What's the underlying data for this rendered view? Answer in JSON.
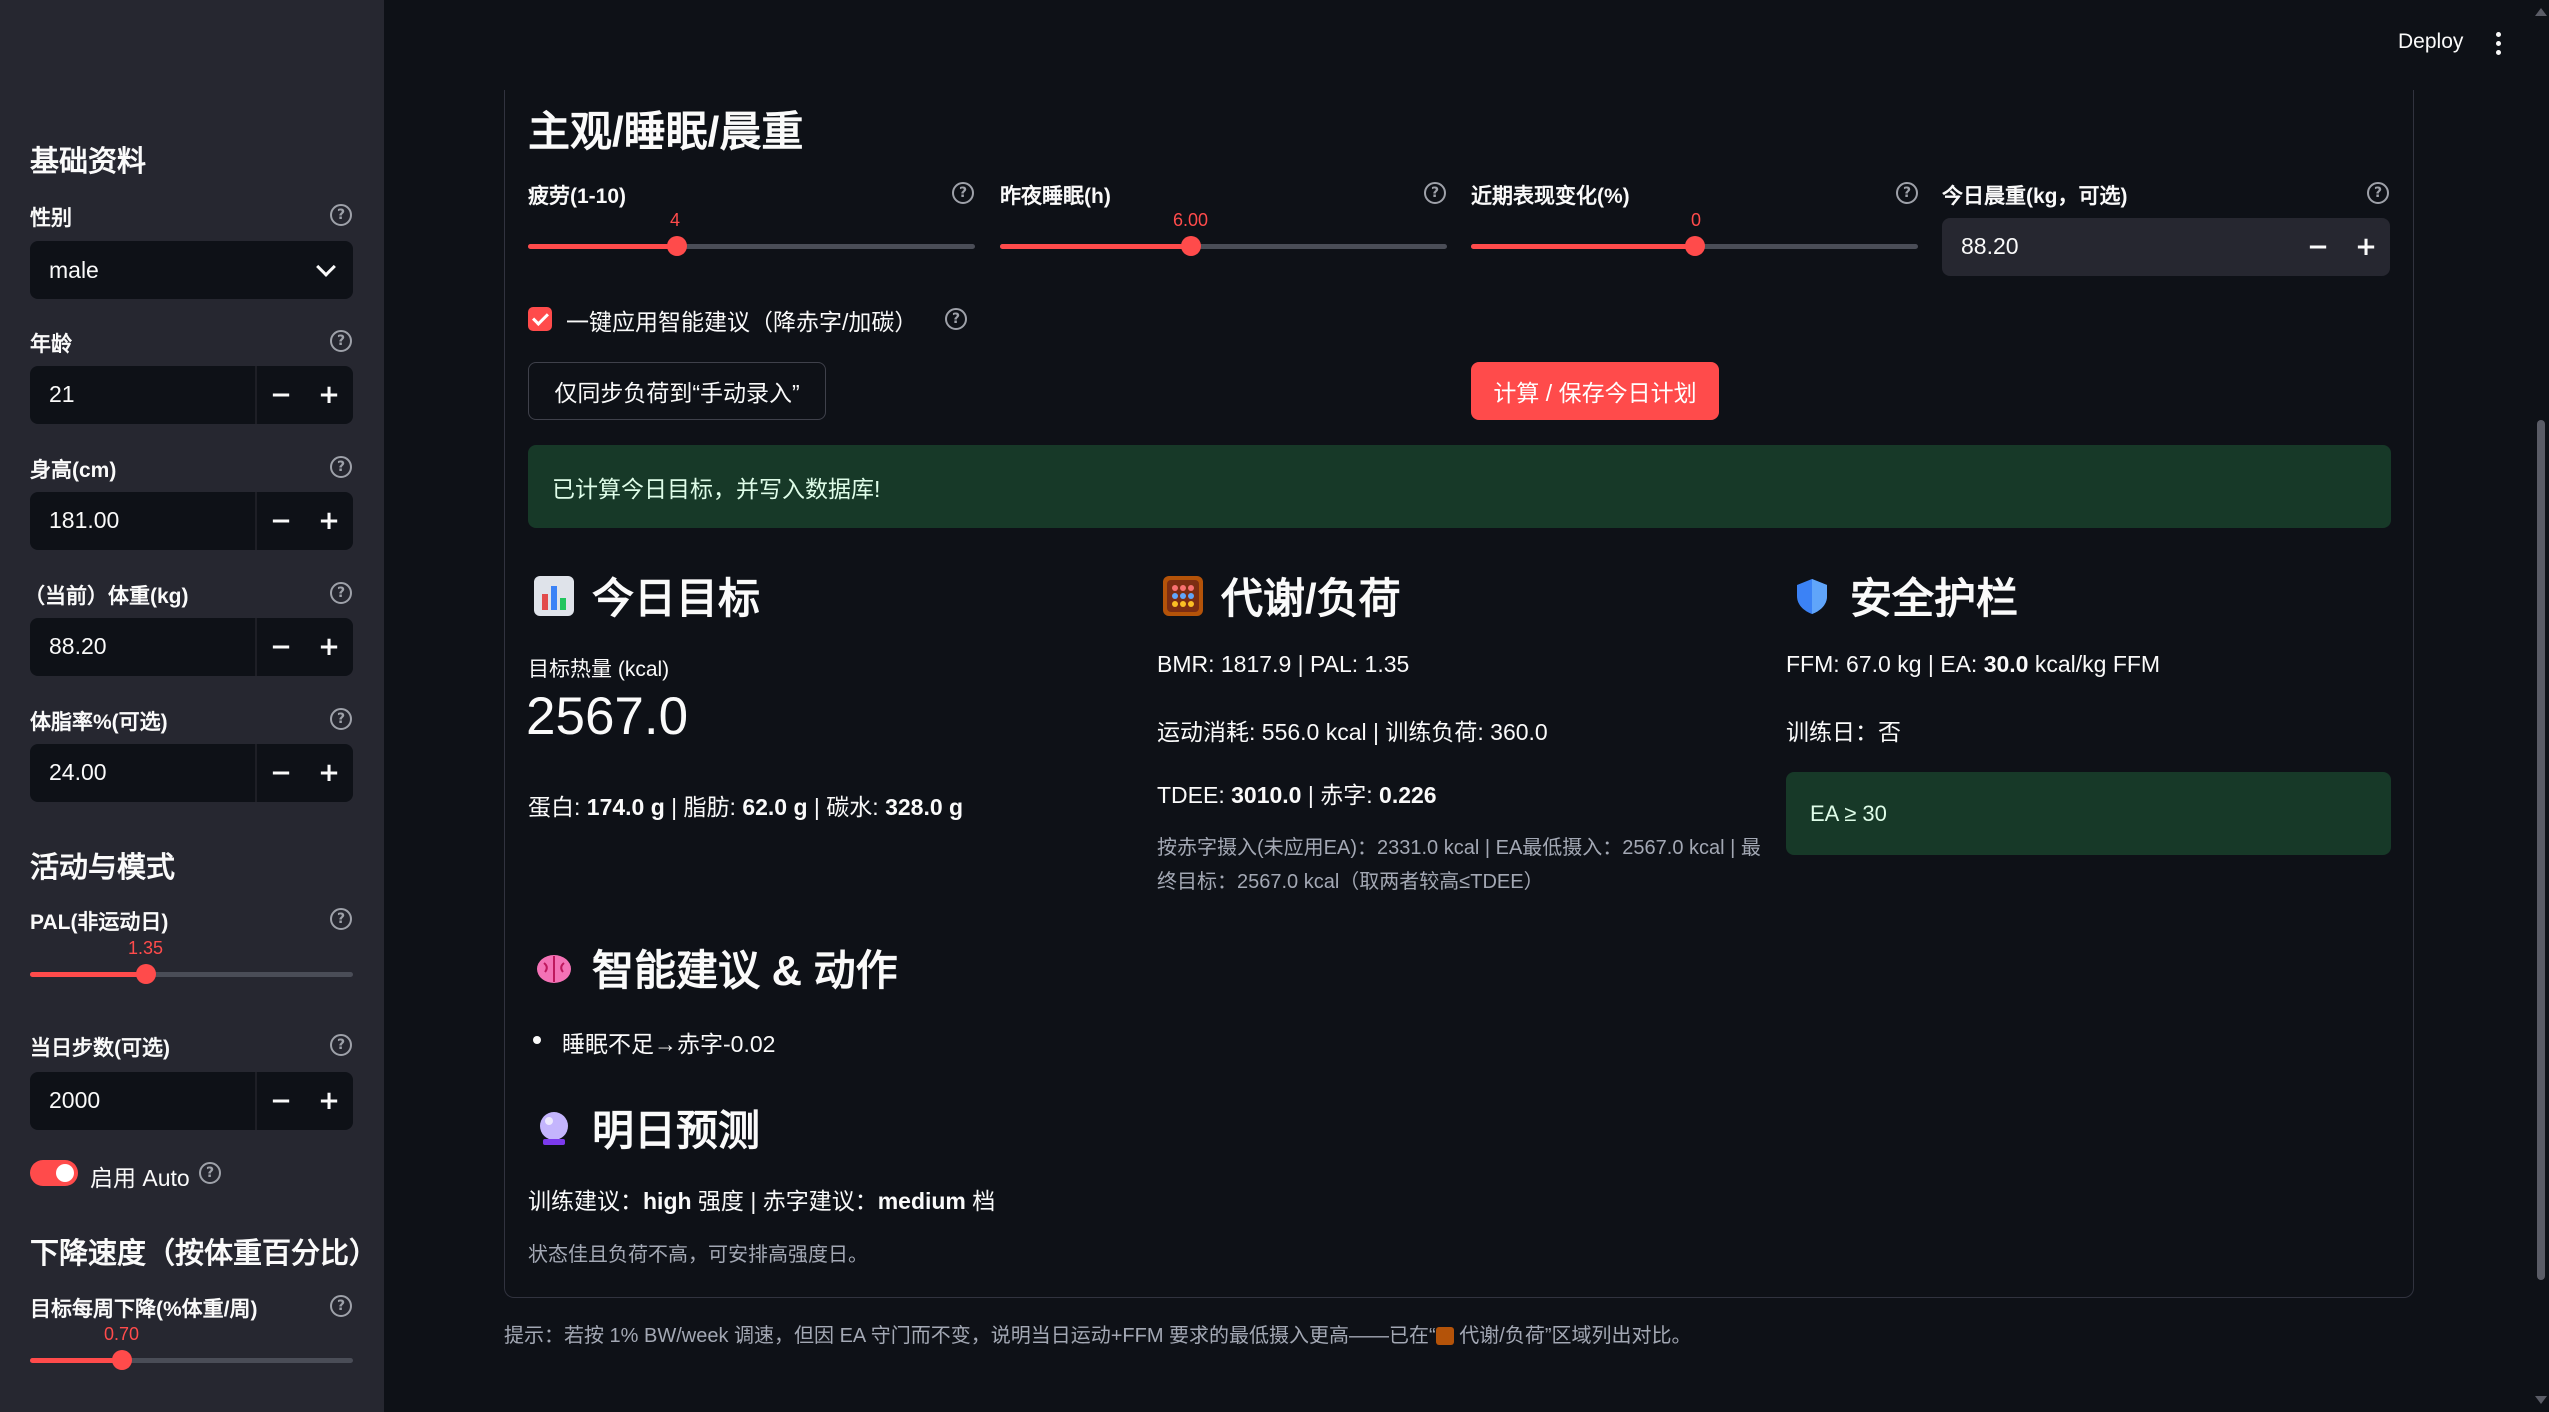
{
  "header": {
    "deploy_label": "Deploy"
  },
  "sidebar": {
    "section_basic": "基础资料",
    "gender": {
      "label": "性别",
      "value": "male"
    },
    "age": {
      "label": "年龄",
      "value": "21"
    },
    "height": {
      "label": "身高(cm)",
      "value": "181.00"
    },
    "weight": {
      "label": "（当前）体重(kg)",
      "value": "88.20"
    },
    "bodyfat": {
      "label": "体脂率%(可选)",
      "value": "24.00"
    },
    "section_activity": "活动与模式",
    "pal": {
      "label": "PAL(非运动日)",
      "value": "1.35",
      "min": 1.2,
      "max": 1.9,
      "level": 0.36
    },
    "steps": {
      "label": "当日步数(可选)",
      "value": "2000"
    },
    "auto_toggle": {
      "label": "启用 Auto",
      "on": true
    },
    "section_speed": "下降速度（按体重百分比）",
    "weekly_drop": {
      "label": "目标每周下降(%体重/周)",
      "value": "0.70",
      "level": 0.28
    }
  },
  "main": {
    "section_title": "主观/睡眠/晨重",
    "fatigue": {
      "label": "疲劳(1-10)",
      "value": "4",
      "level": 0.33
    },
    "sleep": {
      "label": "昨夜睡眠(h)",
      "value": "6.00",
      "level": 0.43
    },
    "perf": {
      "label": "近期表现变化(%)",
      "value": "0",
      "level": 0.5
    },
    "morning_weight": {
      "label": "今日晨重(kg，可选)",
      "value": "88.20"
    },
    "apply_checkbox": {
      "label": "一键应用智能建议（降赤字/加碳）",
      "checked": true
    },
    "sync_button": "仅同步负荷到“手动录入”",
    "calc_button": "计算 / 保存今日计划",
    "success_msg": "已计算今日目标，并写入数据库!",
    "today": {
      "title": "今日目标",
      "icon": "bar-chart-icon",
      "kcal_label": "目标热量 (kcal)",
      "kcal_value": "2567.0",
      "macros_prefix_protein": "蛋白: ",
      "protein": "174.0 g",
      "sep1": " | 脂肪: ",
      "fat": "62.0 g",
      "sep2": " | 碳水: ",
      "carbs": "328.0 g"
    },
    "metabolism": {
      "title": "代谢/负荷",
      "icon": "abacus-icon",
      "line1": "BMR: 1817.9 | PAL: 1.35",
      "line2": "运动消耗: 556.0 kcal | 训练负荷: 360.0",
      "tdee_prefix": "TDEE: ",
      "tdee": "3010.0",
      "deficit_prefix": " | 赤字: ",
      "deficit": "0.226",
      "note_line1": "按赤字摄入(未应用EA)：2331.0 kcal | EA最低摄入：2567.0 kcal | 最",
      "note_line2": "终目标：2567.0 kcal（取两者较高≤TDEE）"
    },
    "safety": {
      "title": "安全护栏",
      "icon": "shield-icon",
      "line1_prefix": "FFM: 67.0 kg | EA: ",
      "ea": "30.0",
      "line1_suffix": " kcal/kg FFM",
      "training_day": "训练日：否",
      "badge": "EA ≥ 30"
    },
    "advice": {
      "title": "智能建议 & 动作",
      "icon": "brain-icon",
      "items": [
        "睡眠不足→赤字-0.02"
      ]
    },
    "forecast": {
      "title": "明日预测",
      "icon": "crystal-ball-icon",
      "line_prefix": "训练建议：",
      "intensity": "high",
      "line_mid": " 强度 | 赤字建议：",
      "deficit_level": "medium",
      "line_suffix": " 档",
      "note": "状态佳且负荷不高，可安排高强度日。"
    },
    "footer_tip": "提示：若按 1% BW/week 调速，但因 EA 守门而不变，说明当日运动+FFM 要求的最低摄入更高——已在“",
    "footer_tip_end": " 代谢/负荷”区域列出对比。"
  },
  "colors": {
    "accent": "#ff4b4b",
    "success_bg": "#173928",
    "sidebar_bg": "#262730",
    "app_bg": "#0e1117"
  }
}
